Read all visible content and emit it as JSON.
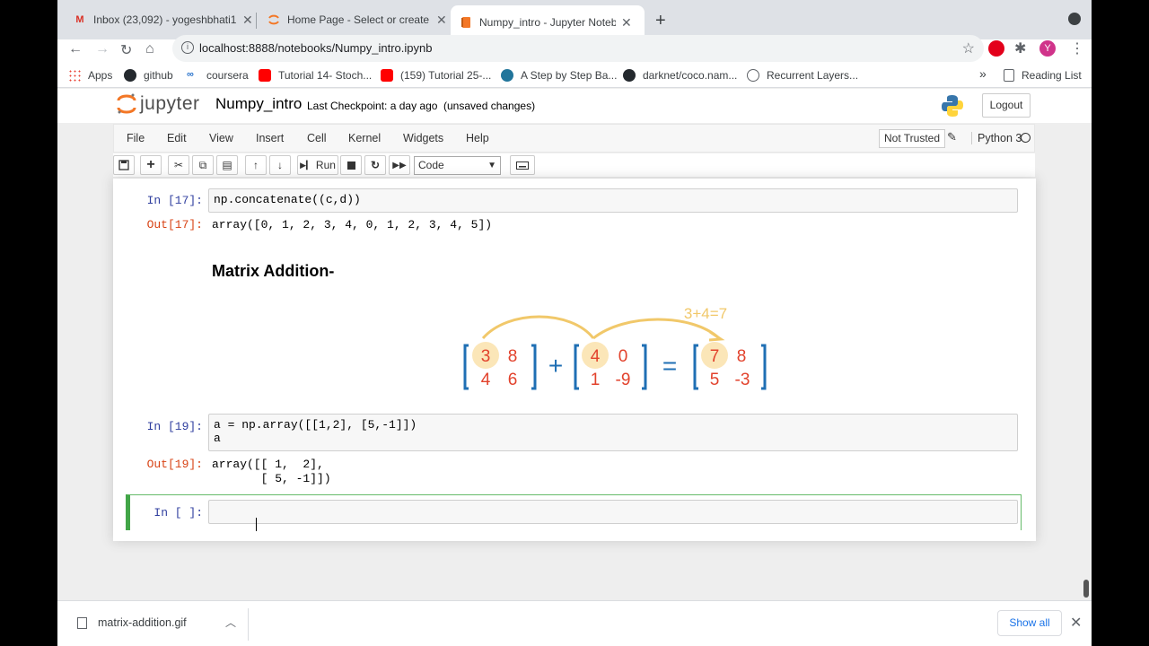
{
  "browser": {
    "tabs": [
      {
        "title": "Inbox (23,092) - yogeshbhati1",
        "favicon": "gmail-icon"
      },
      {
        "title": "Home Page - Select or create a",
        "favicon": "jupyter-icon"
      },
      {
        "title": "Numpy_intro - Jupyter Noteboo",
        "favicon": "notebook-icon"
      }
    ],
    "tab_close": "✕",
    "new_tab": "+",
    "url": "localhost:8888/notebooks/Numpy_intro.ipynb",
    "profile_initial": "Y",
    "bookmarks": [
      {
        "label": "Apps",
        "icon": "apps-grid-icon"
      },
      {
        "label": "github",
        "icon": "github-icon"
      },
      {
        "label": "coursera",
        "icon": "coursera-icon"
      },
      {
        "label": "Tutorial 14- Stoch...",
        "icon": "youtube-icon"
      },
      {
        "label": "(159) Tutorial 25-...",
        "icon": "youtube-icon"
      },
      {
        "label": "A Step by Step Ba...",
        "icon": "wordpress-icon"
      },
      {
        "label": "darknet/coco.nam...",
        "icon": "github-icon"
      },
      {
        "label": "Recurrent Layers...",
        "icon": "globe-icon"
      }
    ],
    "bookmarks_overflow": "»",
    "reading_list": "Reading List"
  },
  "jupyter": {
    "logo_text": "jupyter",
    "notebook_name": "Numpy_intro",
    "checkpoint": "Last Checkpoint: a day ago",
    "unsaved": "(unsaved changes)",
    "logout": "Logout",
    "menu": [
      "File",
      "Edit",
      "View",
      "Insert",
      "Cell",
      "Kernel",
      "Widgets",
      "Help"
    ],
    "trust": "Not Trusted",
    "kernel_name": "Python 3",
    "run_label": "Run",
    "cell_type": "Code"
  },
  "cells": {
    "c17_in_prompt": "In [17]:",
    "c17_code": "np.concatenate((c,d))",
    "c17_out_prompt": "Out[17]:",
    "c17_output": "array([0, 1, 2, 3, 4, 0, 1, 2, 3, 4, 5])",
    "heading": "Matrix Addition-",
    "c19_in_prompt": "In [19]:",
    "c19_code": "a = np.array([[1,2], [5,-1]])\na",
    "c19_out_prompt": "Out[19]:",
    "c19_output": "array([[ 1,  2],\n       [ 5, -1]])",
    "empty_prompt": "In [ ]:"
  },
  "figure": {
    "annotation": "3+4=7",
    "plus": "+",
    "equals": "=",
    "m1": [
      "3",
      "8",
      "4",
      "6"
    ],
    "m2": [
      "4",
      "0",
      "1",
      "-9"
    ],
    "m3": [
      "7",
      "8",
      "5",
      "-3"
    ]
  },
  "downloads": {
    "file": "matrix-addition.gif",
    "show_all": "Show all"
  }
}
